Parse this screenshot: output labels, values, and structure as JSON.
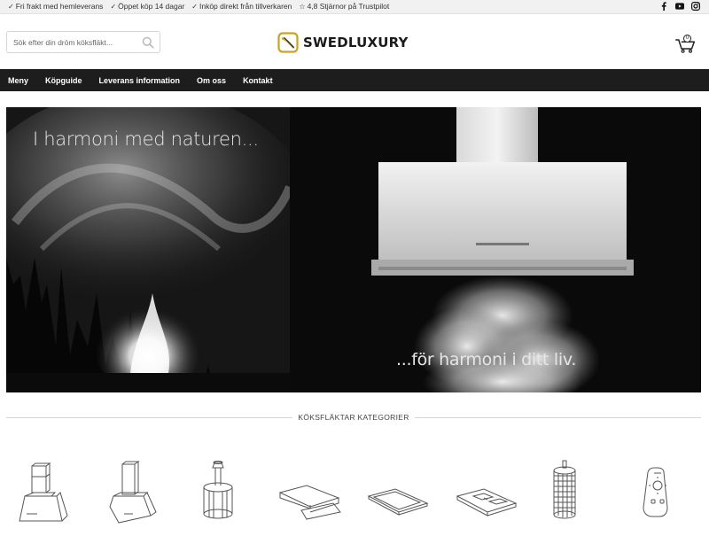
{
  "topbar": {
    "usps": [
      "Fri frakt med hemleverans",
      "Öppet köp 14 dagar",
      "Inköp direkt från tillverkaren",
      "4,8 Stjärnor på Trustpilot"
    ],
    "social": [
      "facebook-icon",
      "youtube-icon",
      "instagram-icon"
    ]
  },
  "header": {
    "search_placeholder": "Sök efter din dröm köksfläkt...",
    "logo_text": "SWEDLUXURY",
    "cart_count": "0",
    "brand_color": "#c9a227"
  },
  "nav": {
    "items": [
      "Meny",
      "Köpguide",
      "Leverans information",
      "Om oss",
      "Kontakt"
    ]
  },
  "hero": {
    "left_caption": "I harmoni med naturen...",
    "right_caption": "...för harmoni i ditt liv."
  },
  "categories": {
    "heading": "KÖKSFLÄKTAR KATEGORIER",
    "icons": [
      "wall-hood-icon",
      "wall-hood-alt-icon",
      "island-cylinder-hood-icon",
      "angled-hood-icon",
      "ceiling-hood-icon",
      "hob-hood-icon",
      "round-island-hood-icon",
      "remote-control-icon"
    ]
  }
}
